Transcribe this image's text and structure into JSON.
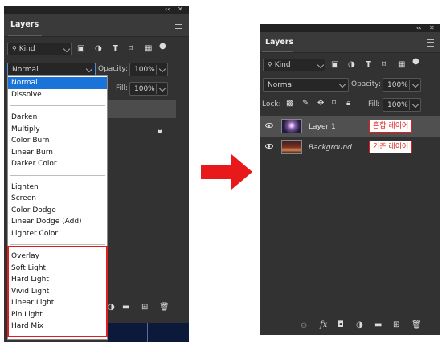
{
  "left_panel": {
    "window_controls": [
      "‹‹",
      "✕"
    ],
    "title": "Layers",
    "filter": {
      "kind_label": "Kind"
    },
    "blend_select": "Normal",
    "opacity_label": "Opacity:",
    "opacity_value": "100%",
    "fill_label": "Fill:",
    "fill_value": "100%",
    "blend_menu": {
      "groups": [
        [
          "Normal",
          "Dissolve"
        ],
        [
          "Darken",
          "Multiply",
          "Color Burn",
          "Linear Burn",
          "Darker Color"
        ],
        [
          "Lighten",
          "Screen",
          "Color Dodge",
          "Linear Dodge (Add)",
          "Lighter Color"
        ],
        [
          "Overlay",
          "Soft Light",
          "Hard Light",
          "Vivid Light",
          "Linear Light",
          "Pin Light",
          "Hard Mix"
        ]
      ],
      "selected": "Normal"
    }
  },
  "right_panel": {
    "window_controls": [
      "‹‹",
      "✕"
    ],
    "title": "Layers",
    "filter": {
      "kind_label": "Kind"
    },
    "blend_select": "Normal",
    "opacity_label": "Opacity:",
    "opacity_value": "100%",
    "lock_label": "Lock:",
    "fill_label": "Fill:",
    "fill_value": "100%",
    "layers": [
      {
        "name": "Layer 1",
        "annotation": "혼합 레이어",
        "italic": false
      },
      {
        "name": "Background",
        "annotation": "기준 레이어",
        "italic": true
      }
    ],
    "footer_icons": [
      "link-icon",
      "fx-icon",
      "mask-icon",
      "adjustment-icon",
      "folder-icon",
      "new-layer-icon",
      "trash-icon"
    ]
  },
  "colors": {
    "panel_bg": "#323232",
    "highlight_red": "#e21b1b",
    "menu_selection": "#1a73d9",
    "arrow_red": "#e8191b"
  }
}
